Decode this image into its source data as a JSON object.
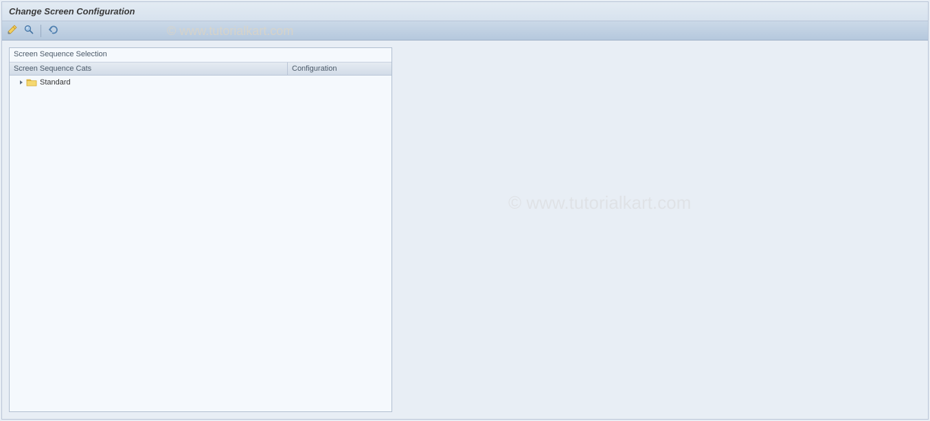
{
  "title": "Change Screen Configuration",
  "toolbar": {
    "buttons": [
      {
        "name": "edit-button",
        "icon": "pencil-icon"
      },
      {
        "name": "check-button",
        "icon": "magnify-icon"
      },
      {
        "name": "back-button",
        "icon": "undo-icon"
      }
    ]
  },
  "panel": {
    "title": "Screen Sequence Selection",
    "columns": {
      "col1": "Screen Sequence Cats",
      "col2": "Configuration"
    },
    "rows": [
      {
        "label": "Standard",
        "expanded": false
      }
    ]
  },
  "watermark": "© www.tutorialkart.com"
}
